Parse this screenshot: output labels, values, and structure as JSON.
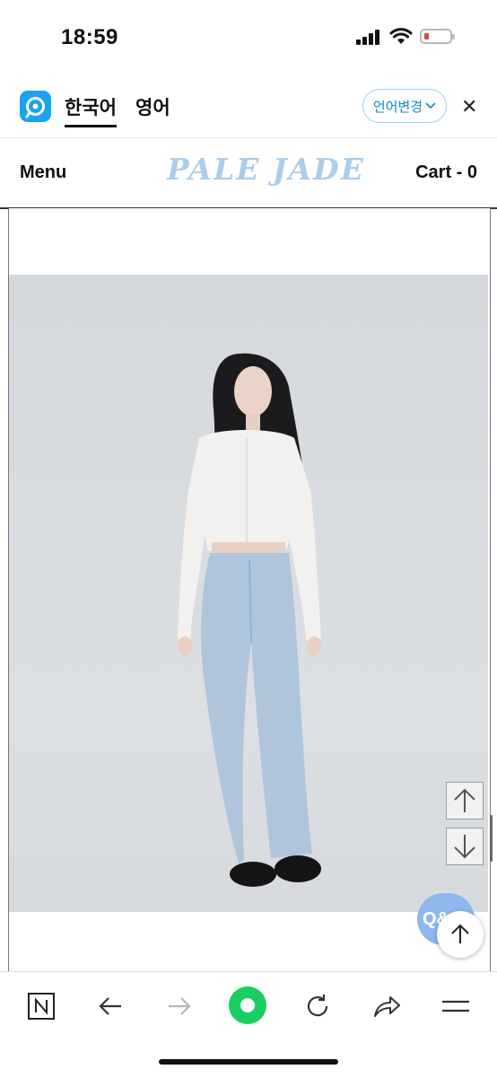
{
  "status_bar": {
    "time": "18:59"
  },
  "translate_bar": {
    "language_tabs": [
      "한국어",
      "영어"
    ],
    "change_language_label": "언어변경"
  },
  "site_header": {
    "menu_label": "Menu",
    "logo_text": "PALE JADE",
    "cart_label": "Cart - 0"
  },
  "floating": {
    "qna_label": "Q&A"
  },
  "colors": {
    "logo": "#aacdea",
    "papago_blue": "#1aa3f2",
    "reload_green": "#19ce60",
    "qna_blue": "#8fb9ee"
  },
  "icons": {
    "toolbar": [
      "naver-n-icon",
      "back-arrow-icon",
      "forward-arrow-icon",
      "green-dot-icon",
      "reload-icon",
      "share-icon",
      "hamburger-menu-icon"
    ]
  }
}
